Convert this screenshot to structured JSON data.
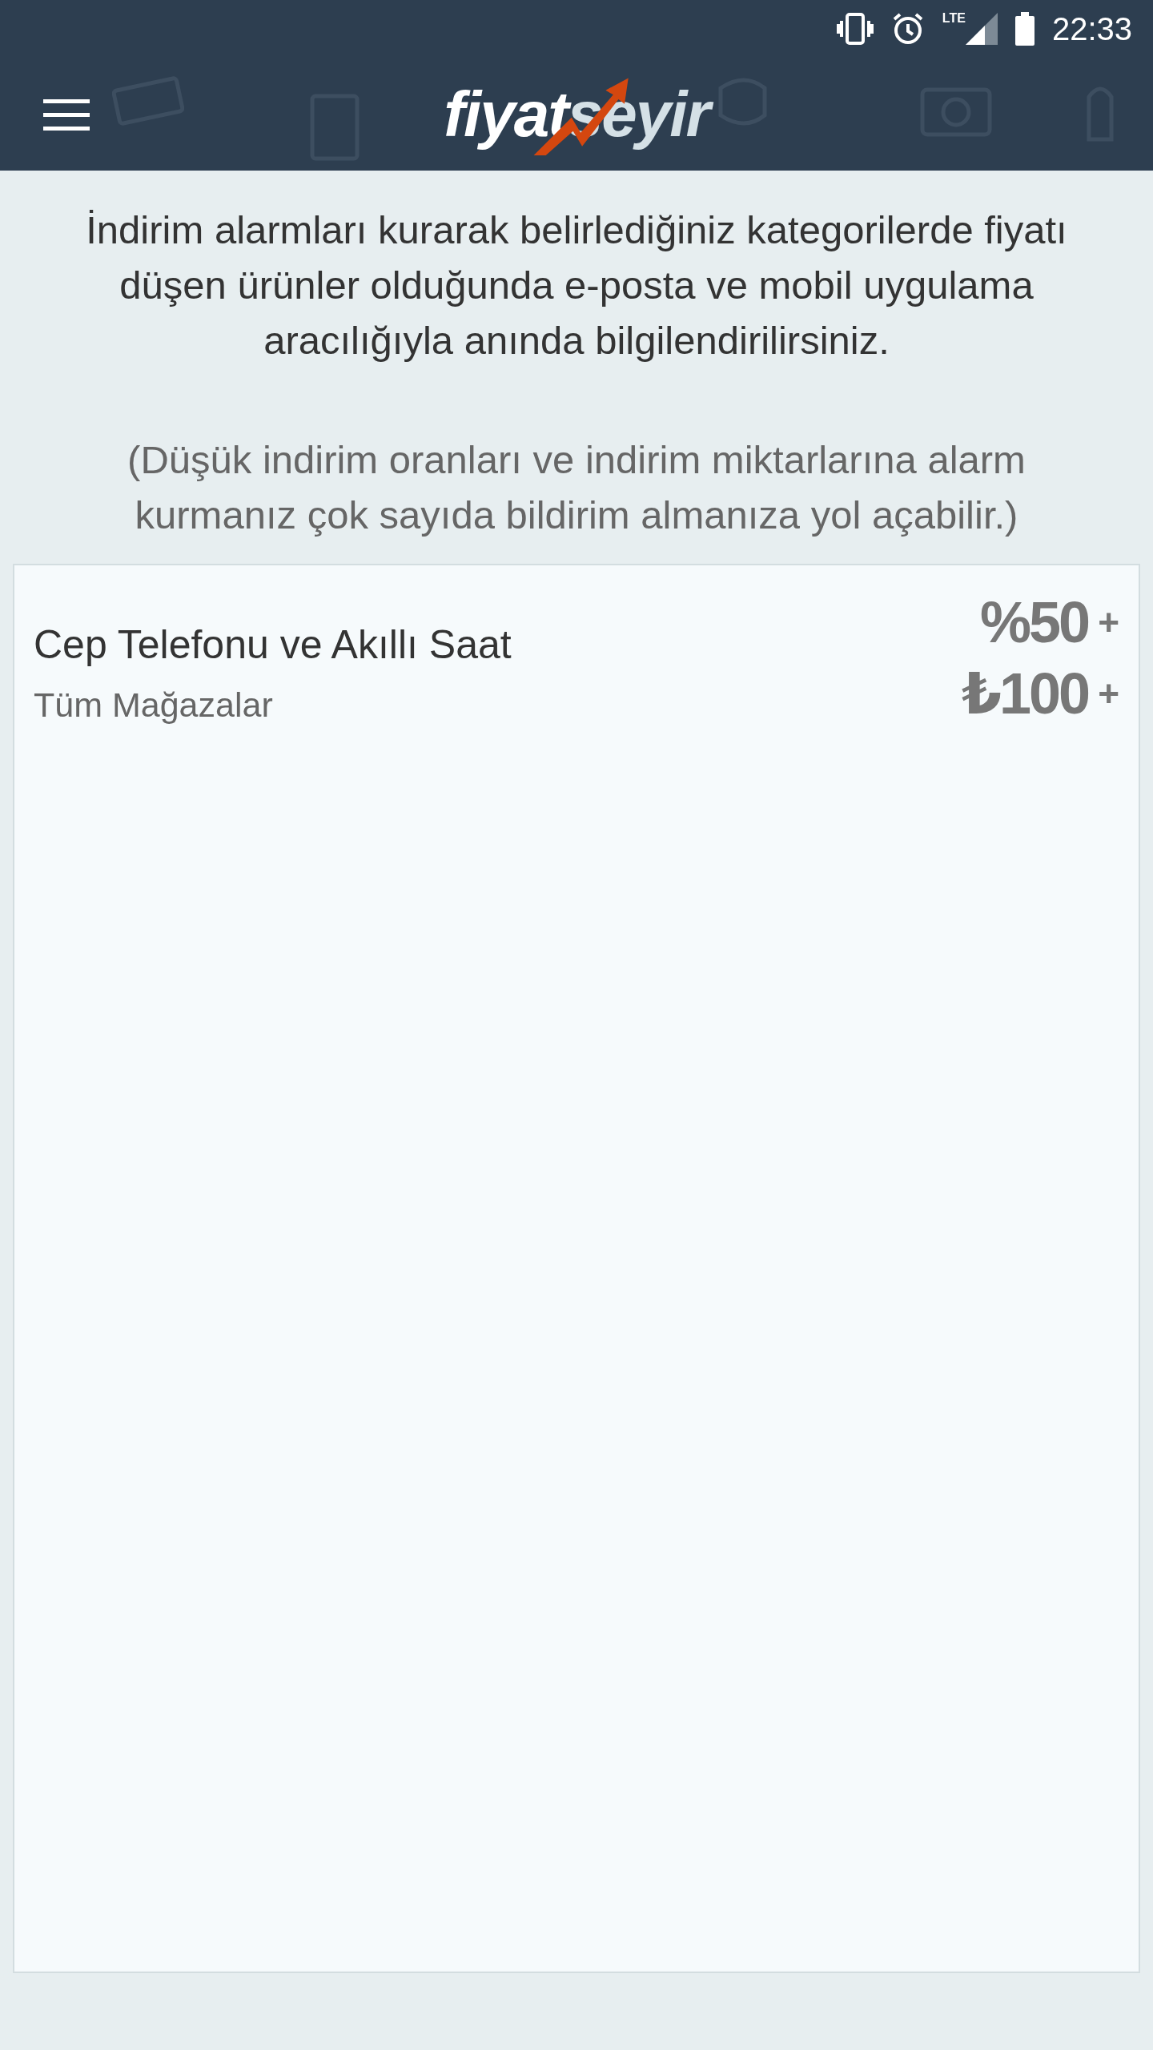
{
  "status_bar": {
    "network": "LTE",
    "time": "22:33"
  },
  "app_bar": {
    "logo": {
      "first": "fiyat",
      "second": "seyir"
    }
  },
  "intro": {
    "text": "İndirim alarmları kurarak belirlediğiniz kategorilerde fiyatı düşen ürünler olduğunda e-posta ve mobil uygulama aracılığıyla anında bilgilendirilirsiniz.",
    "note": "(Düşük indirim oranları ve indirim miktarlarına alarm kurmanız çok sayıda bildirim almanıza yol açabilir.)"
  },
  "alarms": [
    {
      "category": "Cep Telefonu ve Akıllı Saat",
      "store": "Tüm Mağazalar",
      "rate": "%50",
      "rate_suffix": "+",
      "amount": "₺100",
      "amount_suffix": "+"
    }
  ]
}
